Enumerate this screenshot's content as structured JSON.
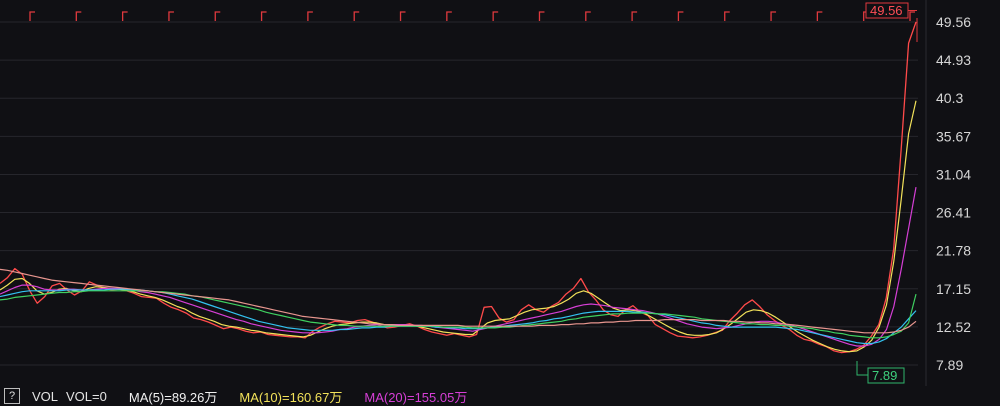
{
  "chart_data": {
    "type": "line",
    "y_ticks": [
      "49.56",
      "44.93",
      "40.3",
      "35.67",
      "31.04",
      "26.41",
      "21.78",
      "17.15",
      "12.52",
      "7.89"
    ],
    "ylim": [
      7.89,
      49.56
    ],
    "grid": "horizontal",
    "high_label": "49.56",
    "low_label": "7.89",
    "series": [
      {
        "color": "#ff4a4a",
        "values": [
          17.8,
          18.5,
          19.6,
          18.9,
          16.9,
          15.4,
          16.2,
          17.5,
          17.8,
          17.0,
          16.4,
          16.9,
          18.0,
          17.6,
          17.2,
          17.0,
          17.1,
          16.9,
          16.6,
          16.2,
          16.1,
          16.0,
          15.4,
          14.9,
          14.6,
          14.2,
          13.6,
          13.4,
          13.1,
          12.7,
          12.3,
          12.5,
          12.3,
          12.0,
          11.8,
          11.9,
          11.6,
          11.5,
          11.4,
          11.3,
          11.3,
          11.2,
          12.0,
          12.5,
          12.9,
          13.2,
          13.1,
          13.0,
          13.3,
          13.4,
          13.1,
          12.7,
          12.4,
          12.5,
          12.7,
          12.9,
          12.6,
          12.2,
          11.9,
          11.7,
          11.5,
          11.7,
          11.5,
          11.3,
          11.6,
          14.9,
          15.0,
          13.6,
          13.1,
          13.4,
          14.6,
          15.2,
          14.6,
          14.3,
          15.0,
          15.5,
          16.5,
          17.2,
          18.4,
          16.8,
          15.8,
          14.6,
          14.0,
          13.8,
          14.6,
          15.1,
          14.3,
          13.9,
          12.8,
          12.3,
          11.8,
          11.4,
          11.3,
          11.2,
          11.3,
          11.5,
          11.8,
          12.1,
          13.3,
          14.2,
          15.2,
          15.8,
          15.0,
          14.0,
          13.3,
          12.7,
          12.2,
          11.5,
          11.0,
          10.8,
          10.4,
          10.1,
          9.6,
          9.4,
          9.5,
          9.8,
          10.3,
          11.4,
          12.8,
          16.0,
          22.0,
          34.0,
          47.0,
          49.56
        ]
      },
      {
        "color": "#f2e25a",
        "values": [
          17.0,
          17.6,
          18.3,
          18.4,
          17.8,
          16.9,
          16.5,
          16.7,
          17.1,
          17.2,
          16.9,
          16.8,
          17.2,
          17.4,
          17.3,
          17.2,
          17.1,
          17.0,
          16.8,
          16.5,
          16.3,
          16.1,
          15.8,
          15.4,
          15.0,
          14.7,
          14.2,
          13.8,
          13.5,
          13.2,
          12.8,
          12.6,
          12.5,
          12.3,
          12.1,
          12.0,
          11.8,
          11.7,
          11.6,
          11.5,
          11.4,
          11.3,
          11.5,
          11.9,
          12.3,
          12.6,
          12.8,
          12.9,
          13.0,
          13.1,
          13.1,
          13.0,
          12.8,
          12.7,
          12.7,
          12.7,
          12.7,
          12.5,
          12.3,
          12.1,
          11.9,
          11.8,
          11.7,
          11.6,
          11.6,
          12.3,
          13.0,
          13.3,
          13.4,
          13.5,
          13.9,
          14.3,
          14.6,
          14.7,
          14.8,
          15.0,
          15.4,
          15.9,
          16.6,
          16.9,
          16.6,
          16.0,
          15.4,
          14.8,
          14.5,
          14.6,
          14.5,
          14.3,
          13.8,
          13.3,
          12.8,
          12.3,
          11.9,
          11.6,
          11.5,
          11.5,
          11.6,
          11.8,
          12.3,
          12.9,
          13.6,
          14.3,
          14.6,
          14.5,
          14.2,
          13.7,
          13.1,
          12.5,
          11.9,
          11.4,
          10.9,
          10.5,
          10.1,
          9.8,
          9.6,
          9.5,
          9.6,
          10.1,
          10.9,
          12.5,
          15.2,
          20.5,
          28.0,
          36.0,
          40.0
        ]
      },
      {
        "color": "#d63fd6",
        "values": [
          16.5,
          16.9,
          17.3,
          17.6,
          17.6,
          17.4,
          17.1,
          17.0,
          17.0,
          17.1,
          17.1,
          17.0,
          17.0,
          17.1,
          17.2,
          17.2,
          17.2,
          17.1,
          17.0,
          16.8,
          16.7,
          16.5,
          16.3,
          16.1,
          15.8,
          15.5,
          15.2,
          14.9,
          14.6,
          14.3,
          14.0,
          13.7,
          13.4,
          13.2,
          12.9,
          12.7,
          12.5,
          12.3,
          12.1,
          12.0,
          11.9,
          11.8,
          11.8,
          11.8,
          11.9,
          12.0,
          12.2,
          12.3,
          12.5,
          12.6,
          12.7,
          12.8,
          12.8,
          12.8,
          12.8,
          12.8,
          12.7,
          12.7,
          12.6,
          12.5,
          12.4,
          12.3,
          12.2,
          12.1,
          12.0,
          12.2,
          12.4,
          12.6,
          12.8,
          13.0,
          13.2,
          13.4,
          13.6,
          13.8,
          14.0,
          14.2,
          14.4,
          14.7,
          15.0,
          15.2,
          15.3,
          15.2,
          15.1,
          14.9,
          14.8,
          14.7,
          14.6,
          14.5,
          14.3,
          14.1,
          13.8,
          13.5,
          13.2,
          12.9,
          12.7,
          12.5,
          12.4,
          12.3,
          12.4,
          12.5,
          12.7,
          12.9,
          13.1,
          13.2,
          13.2,
          13.1,
          12.9,
          12.7,
          12.5,
          12.2,
          11.9,
          11.6,
          11.3,
          11.0,
          10.7,
          10.4,
          10.2,
          10.2,
          10.4,
          11.0,
          12.2,
          15.0,
          19.5,
          24.5,
          29.5
        ]
      },
      {
        "color": "#33c2f0",
        "values": [
          16.2,
          16.4,
          16.6,
          16.8,
          16.9,
          16.9,
          16.9,
          16.9,
          16.9,
          17.0,
          17.0,
          17.0,
          17.0,
          17.0,
          17.0,
          17.1,
          17.1,
          17.1,
          17.0,
          17.0,
          16.9,
          16.8,
          16.7,
          16.5,
          16.3,
          16.1,
          15.9,
          15.6,
          15.3,
          15.0,
          14.7,
          14.4,
          14.1,
          13.8,
          13.5,
          13.2,
          13.0,
          12.8,
          12.6,
          12.4,
          12.3,
          12.2,
          12.1,
          12.1,
          12.1,
          12.1,
          12.2,
          12.2,
          12.3,
          12.4,
          12.4,
          12.5,
          12.5,
          12.6,
          12.6,
          12.6,
          12.6,
          12.6,
          12.6,
          12.5,
          12.5,
          12.4,
          12.4,
          12.3,
          12.3,
          12.3,
          12.4,
          12.5,
          12.6,
          12.7,
          12.8,
          12.9,
          13.0,
          13.2,
          13.3,
          13.5,
          13.6,
          13.8,
          14.0,
          14.2,
          14.3,
          14.4,
          14.4,
          14.4,
          14.4,
          14.4,
          14.3,
          14.3,
          14.2,
          14.1,
          14.0,
          13.8,
          13.6,
          13.4,
          13.2,
          13.0,
          12.9,
          12.7,
          12.6,
          12.5,
          12.5,
          12.5,
          12.5,
          12.5,
          12.5,
          12.5,
          12.4,
          12.3,
          12.2,
          12.0,
          11.8,
          11.6,
          11.4,
          11.2,
          11.0,
          10.8,
          10.6,
          10.5,
          10.5,
          10.7,
          11.1,
          11.8,
          12.5,
          13.5,
          14.5
        ]
      },
      {
        "color": "#3fd060",
        "values": [
          15.8,
          15.9,
          16.1,
          16.2,
          16.3,
          16.4,
          16.5,
          16.6,
          16.7,
          16.7,
          16.8,
          16.8,
          16.9,
          16.9,
          16.9,
          16.9,
          16.9,
          16.9,
          16.9,
          16.9,
          16.9,
          16.8,
          16.8,
          16.7,
          16.6,
          16.5,
          16.3,
          16.2,
          16.0,
          15.8,
          15.6,
          15.4,
          15.2,
          15.0,
          14.8,
          14.6,
          14.3,
          14.1,
          13.9,
          13.7,
          13.5,
          13.3,
          13.1,
          13.0,
          12.9,
          12.8,
          12.7,
          12.7,
          12.6,
          12.6,
          12.6,
          12.6,
          12.6,
          12.6,
          12.6,
          12.6,
          12.6,
          12.6,
          12.6,
          12.6,
          12.5,
          12.5,
          12.5,
          12.5,
          12.4,
          12.4,
          12.4,
          12.4,
          12.5,
          12.5,
          12.6,
          12.7,
          12.8,
          12.9,
          13.0,
          13.1,
          13.2,
          13.4,
          13.5,
          13.7,
          13.8,
          13.9,
          14.0,
          14.1,
          14.1,
          14.2,
          14.2,
          14.2,
          14.2,
          14.1,
          14.1,
          14.0,
          13.9,
          13.8,
          13.7,
          13.5,
          13.4,
          13.3,
          13.2,
          13.1,
          13.0,
          12.9,
          12.9,
          12.8,
          12.8,
          12.7,
          12.7,
          12.6,
          12.5,
          12.4,
          12.3,
          12.1,
          12.0,
          11.8,
          11.7,
          11.5,
          11.4,
          11.3,
          11.2,
          11.2,
          11.3,
          11.6,
          12.0,
          13.0,
          16.5
        ]
      },
      {
        "color": "#e8968f",
        "values": [
          19.5,
          19.4,
          19.2,
          19.0,
          18.8,
          18.6,
          18.4,
          18.2,
          18.1,
          18.0,
          17.9,
          17.8,
          17.7,
          17.6,
          17.5,
          17.4,
          17.3,
          17.2,
          17.1,
          17.0,
          16.9,
          16.8,
          16.7,
          16.6,
          16.5,
          16.4,
          16.3,
          16.2,
          16.1,
          16.0,
          15.9,
          15.8,
          15.6,
          15.4,
          15.2,
          15.0,
          14.8,
          14.6,
          14.4,
          14.2,
          14.0,
          13.8,
          13.7,
          13.6,
          13.5,
          13.4,
          13.3,
          13.2,
          13.1,
          13.0,
          12.9,
          12.9,
          12.8,
          12.8,
          12.7,
          12.7,
          12.7,
          12.7,
          12.7,
          12.7,
          12.7,
          12.7,
          12.7,
          12.6,
          12.6,
          12.6,
          12.6,
          12.6,
          12.6,
          12.6,
          12.6,
          12.6,
          12.6,
          12.7,
          12.7,
          12.7,
          12.8,
          12.8,
          12.9,
          12.9,
          13.0,
          13.0,
          13.1,
          13.1,
          13.2,
          13.2,
          13.3,
          13.3,
          13.3,
          13.3,
          13.4,
          13.4,
          13.4,
          13.4,
          13.4,
          13.3,
          13.3,
          13.3,
          13.3,
          13.2,
          13.2,
          13.1,
          13.1,
          13.0,
          13.0,
          12.9,
          12.9,
          12.8,
          12.7,
          12.6,
          12.5,
          12.4,
          12.3,
          12.2,
          12.1,
          12.0,
          11.9,
          11.8,
          11.8,
          11.8,
          11.8,
          11.9,
          12.1,
          12.5,
          13.2
        ]
      }
    ],
    "event_flags": 20
  },
  "bottom_bar": {
    "help": "?",
    "vol_title": "VOL",
    "vol_value": "VOL=0",
    "ma5": "MA(5)=89.26万",
    "ma10": "MA(10)=160.67万",
    "ma20": "MA(20)=155.05万"
  }
}
